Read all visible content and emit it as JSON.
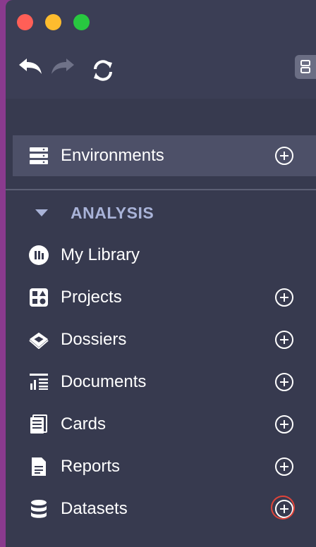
{
  "toolbar": {
    "undo_icon": "undo-icon",
    "redo_icon": "redo-icon",
    "sync_icon": "sync-icon",
    "view_toggle_icon": "grid-view-icon"
  },
  "environments": {
    "label": "Environments",
    "icon": "server-icon"
  },
  "section": {
    "label": "ANALYSIS"
  },
  "items": [
    {
      "label": "My Library",
      "icon": "library-icon",
      "add": false
    },
    {
      "label": "Projects",
      "icon": "projects-icon",
      "add": true
    },
    {
      "label": "Dossiers",
      "icon": "dossiers-icon",
      "add": true
    },
    {
      "label": "Documents",
      "icon": "documents-icon",
      "add": true
    },
    {
      "label": "Cards",
      "icon": "cards-icon",
      "add": true
    },
    {
      "label": "Reports",
      "icon": "reports-icon",
      "add": true
    },
    {
      "label": "Datasets",
      "icon": "datasets-icon",
      "add": true,
      "highlighted": true
    }
  ],
  "colors": {
    "background": "#3b3e55",
    "selected_row": "#4d5068",
    "section_label": "#a9b3d8",
    "highlight_ring": "#e0443a"
  }
}
